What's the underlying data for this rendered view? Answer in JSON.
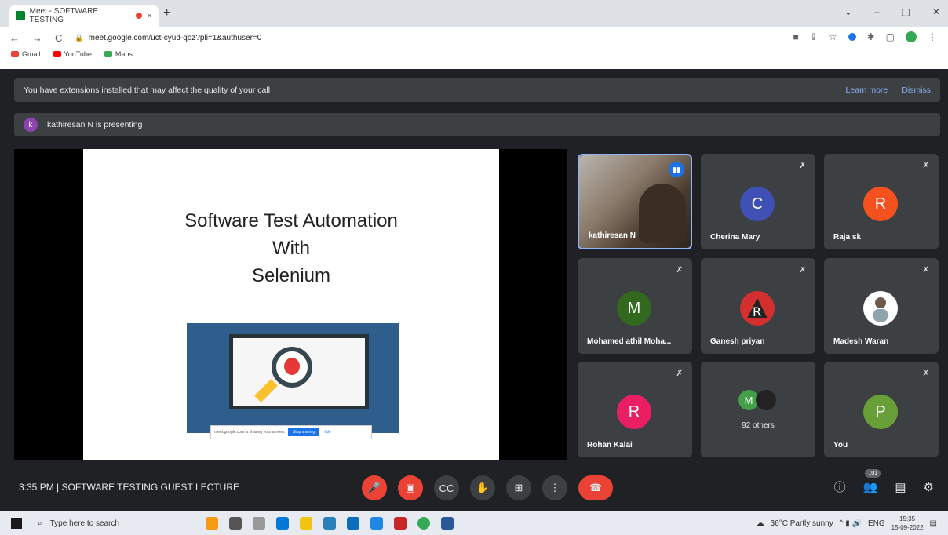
{
  "browser": {
    "tab_title": "Meet - SOFTWARE TESTING",
    "tab_close": "×",
    "new_tab": "+",
    "url": "meet.google.com/uct-cyud-qoz?pli=1&authuser=0",
    "bookmarks": [
      {
        "label": "Gmail",
        "color": "#ea4335"
      },
      {
        "label": "YouTube",
        "color": "#ff0000"
      },
      {
        "label": "Maps",
        "color": "#34a853"
      }
    ]
  },
  "banner": {
    "text": "You have extensions installed that may affect the quality of your call",
    "learn_more": "Learn more",
    "dismiss": "Dismiss"
  },
  "presenting": {
    "initial": "k",
    "text": "kathiresan N is presenting"
  },
  "slide": {
    "line1": "Software Test Automation",
    "line2": "With",
    "line3": "Selenium",
    "share_text": "meet.google.com is sharing your screen.",
    "stop_sharing": "Stop sharing",
    "hide": "Hide"
  },
  "participants": [
    {
      "name": "kathiresan N",
      "initial": "",
      "color": "",
      "video": true
    },
    {
      "name": "Cherina Mary",
      "initial": "C",
      "color": "#3f51b5"
    },
    {
      "name": "Raja sk",
      "initial": "R",
      "color": "#f4511e"
    },
    {
      "name": "Mohamed athil Moha...",
      "initial": "M",
      "color": "#33691e"
    },
    {
      "name": "Ganesh priyan",
      "initial": "",
      "color": "#d32f2f"
    },
    {
      "name": "Madesh Waran",
      "initial": "",
      "color": "#ffffff"
    },
    {
      "name": "Rohan Kalai",
      "initial": "R",
      "color": "#e91e63"
    },
    {
      "name": "92 others",
      "initial": "M",
      "color": "#43a047"
    },
    {
      "name": "You",
      "initial": "P",
      "color": "#689f38"
    }
  ],
  "bottom": {
    "time": "3:35 PM",
    "separator": "|",
    "meeting_name": "SOFTWARE TESTING GUEST LECTURE",
    "people_count": "101"
  },
  "taskbar": {
    "search_placeholder": "Type here to search",
    "weather": "36°C  Partly sunny",
    "lang": "ENG",
    "time": "15:35",
    "date": "15-09-2022"
  }
}
